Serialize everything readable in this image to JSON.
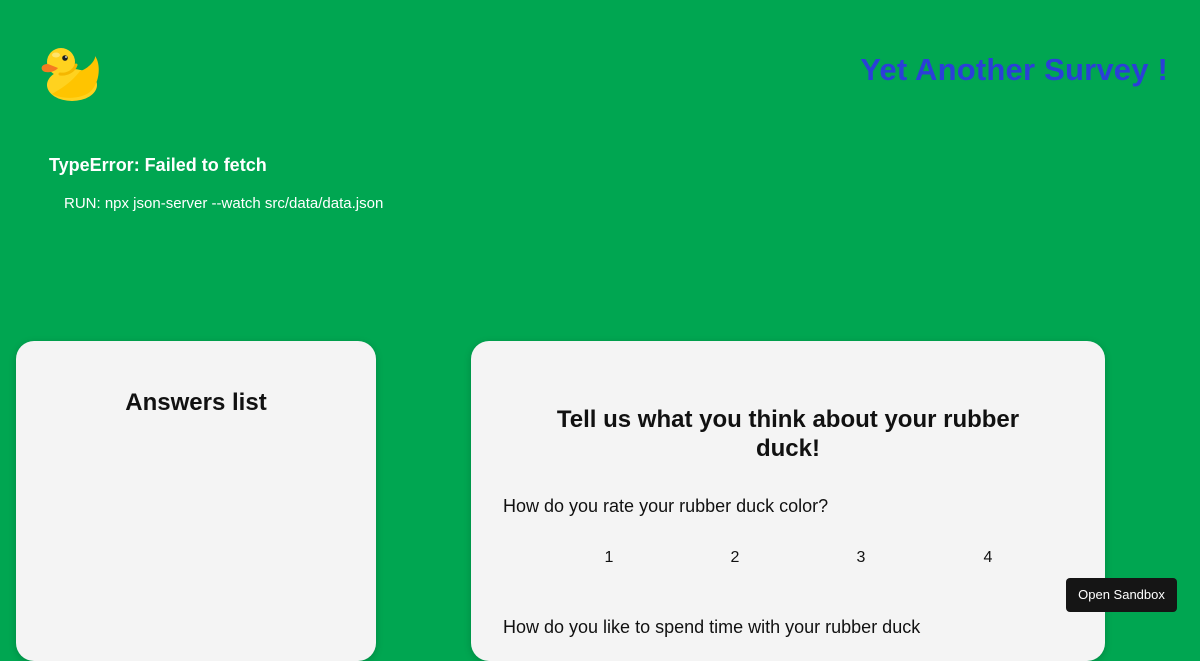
{
  "header": {
    "logo_icon": "rubber-duck-icon",
    "title": "Yet Another Survey !"
  },
  "error": {
    "title": "TypeError: Failed to fetch",
    "run": "RUN: npx json-server --watch src/data/data.json"
  },
  "answers": {
    "title": "Answers list"
  },
  "survey": {
    "title": "Tell us what you think about your rubber duck!",
    "questions": [
      {
        "label": "How do you rate your rubber duck color?",
        "options": [
          "1",
          "2",
          "3",
          "4"
        ]
      },
      {
        "label": "How do you like to spend time with your rubber duck"
      }
    ]
  },
  "sandbox": {
    "label": "Open Sandbox"
  },
  "colors": {
    "background": "#00a651",
    "title": "#2b3fd8",
    "card": "#f4f4f4",
    "button": "#151515"
  }
}
